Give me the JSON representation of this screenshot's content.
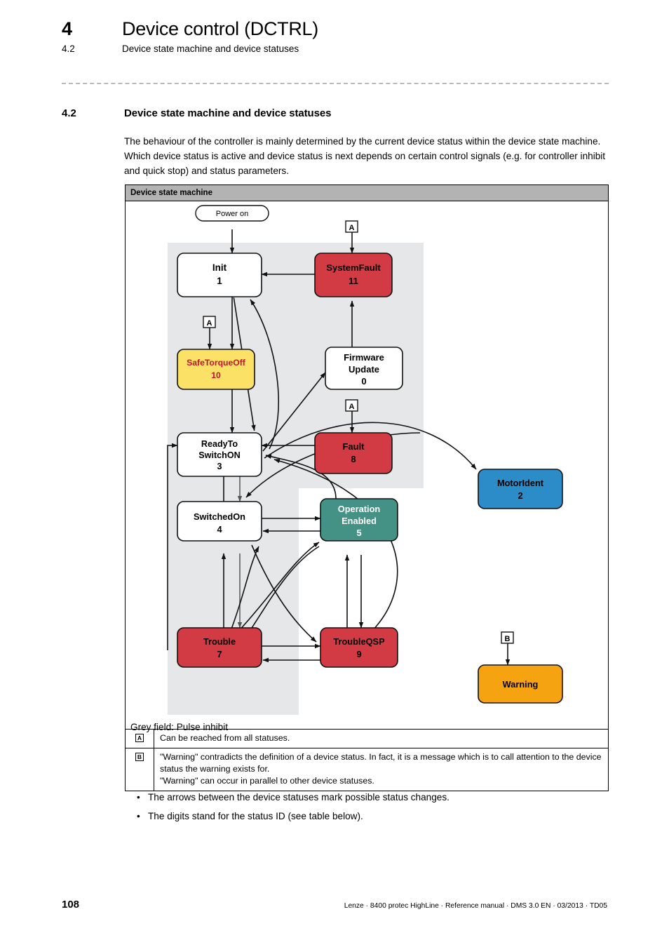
{
  "header": {
    "chapter_number": "4",
    "chapter_title": "Device control (DCTRL)",
    "section_number": "4.2",
    "section_title": "Device state machine and device statuses"
  },
  "section": {
    "number": "4.2",
    "title": "Device state machine and device statuses",
    "paragraph": "The behaviour of the controller is mainly determined by the current device status within the device state machine. Which device status is active and device status is next depends on certain control signals (e.g. for controller inhibit and quick stop) and status parameters."
  },
  "figure": {
    "caption": "Device state machine",
    "grey_field_note": "Grey field: Pulse inhibit",
    "start_label": "Power on",
    "markers": {
      "a": "A",
      "b": "B"
    },
    "states": [
      {
        "id": "init",
        "name": "Init",
        "line2": "",
        "status_id": "1",
        "fill": "#ffffff",
        "text": "#000000"
      },
      {
        "id": "systemfault",
        "name": "SystemFault",
        "line2": "",
        "status_id": "11",
        "fill": "#d23b43",
        "text": "#000000"
      },
      {
        "id": "safetorqueoff",
        "name": "SafeTorqueOff",
        "line2": "",
        "status_id": "10",
        "fill": "#fbe266",
        "text": "#c8102e"
      },
      {
        "id": "firmware",
        "name": "Firmware",
        "line2": "Update",
        "status_id": "0",
        "fill": "#ffffff",
        "text": "#000000"
      },
      {
        "id": "ready",
        "name": "ReadyTo",
        "line2": "SwitchON",
        "status_id": "3",
        "fill": "#ffffff",
        "text": "#000000"
      },
      {
        "id": "fault",
        "name": "Fault",
        "line2": "",
        "status_id": "8",
        "fill": "#d23b43",
        "text": "#000000"
      },
      {
        "id": "switchedon",
        "name": "SwitchedOn",
        "line2": "",
        "status_id": "4",
        "fill": "#ffffff",
        "text": "#000000"
      },
      {
        "id": "operation",
        "name": "Operation",
        "line2": "Enabled",
        "status_id": "5",
        "fill": "#449185",
        "text": "#ffffff"
      },
      {
        "id": "motorident",
        "name": "MotorIdent",
        "line2": "",
        "status_id": "2",
        "fill": "#2b8cc8",
        "text": "#000000"
      },
      {
        "id": "trouble",
        "name": "Trouble",
        "line2": "",
        "status_id": "7",
        "fill": "#d23b43",
        "text": "#000000"
      },
      {
        "id": "troubleqsp",
        "name": "TroubleQSP",
        "line2": "",
        "status_id": "9",
        "fill": "#d23b43",
        "text": "#000000"
      },
      {
        "id": "warning",
        "name": "Warning",
        "line2": "",
        "status_id": "",
        "fill": "#f5a311",
        "text": "#000000"
      }
    ],
    "legend": [
      {
        "key": "A",
        "text": "Can be reached from all statuses."
      },
      {
        "key": "B",
        "text": "\"Warning\" contradicts the definition of a device status. In fact, it is a message which is to call attention to the device status the warning exists for.\n\"Warning\" can occur in parallel to other device statuses."
      }
    ]
  },
  "bullets": [
    "The arrows between the device statuses mark possible status changes.",
    "The digits stand for the status ID (see table below)."
  ],
  "footer": {
    "page_number": "108",
    "reference": "Lenze · 8400 protec HighLine · Reference manual · DMS 3.0 EN · 03/2013 · TD05"
  },
  "colors": {
    "fault_red": "#d23b43",
    "warning_orange": "#f5a311",
    "safe_yellow": "#fbe266",
    "operation_teal": "#449185",
    "motorident_blue": "#2b8cc8",
    "grey_field": "#e5e7e8",
    "caption_bar": "#b3b3b3"
  }
}
